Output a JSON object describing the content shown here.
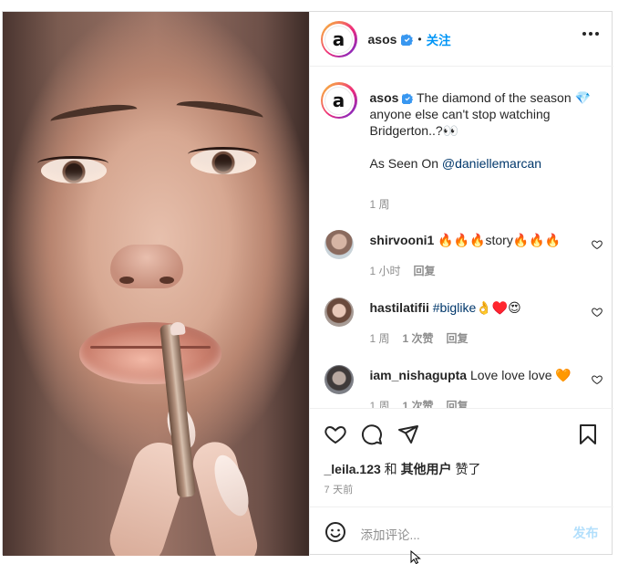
{
  "header": {
    "username": "asos",
    "separator": "•",
    "follow_label": "关注",
    "more_icon": "more-horizontal-icon"
  },
  "caption": {
    "username": "asos",
    "line1": "The diamond of the season 💎",
    "line2": "anyone else can't stop watching",
    "line3": "Bridgerton..?👀",
    "seen_prefix": "As Seen On ",
    "seen_link": "@daniellemarcan",
    "time": "1 周"
  },
  "comments": [
    {
      "username": "shirvooni1",
      "text": "🔥🔥🔥story🔥🔥🔥",
      "time": "1 小时",
      "likes": "",
      "reply": "回复"
    },
    {
      "username": "hastilatifii",
      "tag": "#biglike",
      "text": "👌♥️😍",
      "time": "1 周",
      "likes": "1 次赞",
      "reply": "回复"
    },
    {
      "username": "iam_nishagupta",
      "text": "Love love love 🧡",
      "time": "1 周",
      "likes": "1 次赞",
      "reply": "回复"
    }
  ],
  "actions": {
    "icons": [
      "heart-icon",
      "comment-icon",
      "share-icon",
      "bookmark-icon"
    ],
    "liked_by_user": "_leila.123",
    "liked_and": " 和 ",
    "liked_others": "其他用户",
    "liked_suffix": " 赞了",
    "posted_ago": "7 天前"
  },
  "comment_input": {
    "placeholder": "添加评论...",
    "post_label": "发布",
    "emoji_icon": "emoji-icon"
  },
  "colors": {
    "accent": "#0095f6",
    "link": "#00376b",
    "muted": "#8e8e8e",
    "post_disabled": "#b2dffc",
    "verified": "#3897f0"
  }
}
